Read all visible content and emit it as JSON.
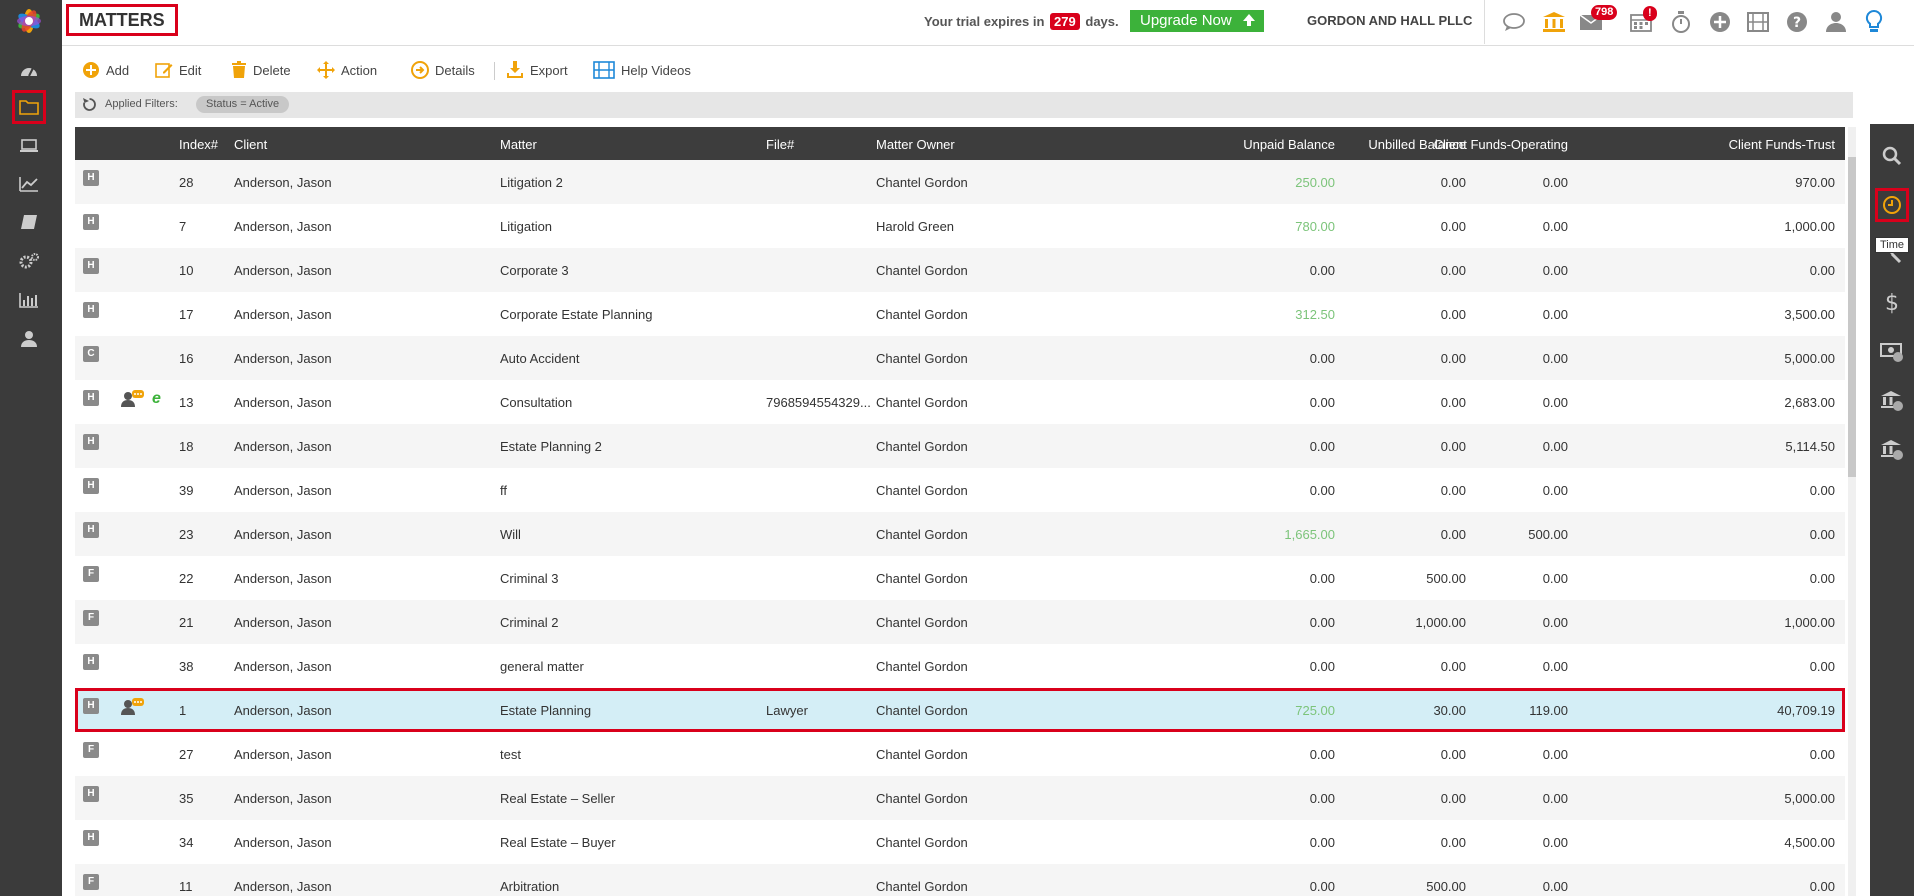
{
  "sidebar": {
    "items": [
      {
        "name": "dashboard-icon"
      },
      {
        "name": "folder-icon",
        "active": true
      },
      {
        "name": "laptop-icon"
      },
      {
        "name": "chart-line-icon"
      },
      {
        "name": "book-icon"
      },
      {
        "name": "gears-icon"
      },
      {
        "name": "bar-chart-icon"
      },
      {
        "name": "user-icon"
      }
    ]
  },
  "header": {
    "title": "MATTERS",
    "trial_prefix": "Your trial expires in",
    "trial_days": "279",
    "trial_suffix": "days.",
    "upgrade_label": "Upgrade Now",
    "firm_name": "GORDON AND HALL PLLC",
    "mail_count": "798",
    "calendar_badge": "!"
  },
  "toolbar": {
    "add": "Add",
    "edit": "Edit",
    "delete": "Delete",
    "action": "Action",
    "details": "Details",
    "export": "Export",
    "help_videos": "Help Videos"
  },
  "filters": {
    "label": "Applied Filters:",
    "chip": "Status = Active"
  },
  "table": {
    "columns": {
      "index": "Index#",
      "client": "Client",
      "matter": "Matter",
      "file": "File#",
      "owner": "Matter Owner",
      "unpaid": "Unpaid Balance",
      "unbilled": "Unbilled Balance",
      "operating": "Client Funds-Operating",
      "trust": "Client Funds-Trust"
    },
    "rows": [
      {
        "badge": "H",
        "index": "28",
        "client": "Anderson, Jason",
        "matter": "Litigation 2",
        "file": "",
        "owner": "Chantel Gordon",
        "unpaid": "250.00",
        "unbilled": "0.00",
        "operating": "0.00",
        "trust": "970.00",
        "unpaid_positive": true
      },
      {
        "badge": "H",
        "index": "7",
        "client": "Anderson, Jason",
        "matter": "Litigation",
        "file": "",
        "owner": "Harold Green",
        "unpaid": "780.00",
        "unbilled": "0.00",
        "operating": "0.00",
        "trust": "1,000.00",
        "unpaid_positive": true
      },
      {
        "badge": "H",
        "index": "10",
        "client": "Anderson, Jason",
        "matter": "Corporate 3",
        "file": "",
        "owner": "Chantel Gordon",
        "unpaid": "0.00",
        "unbilled": "0.00",
        "operating": "0.00",
        "trust": "0.00"
      },
      {
        "badge": "H",
        "index": "17",
        "client": "Anderson, Jason",
        "matter": "Corporate Estate Planning",
        "file": "",
        "owner": "Chantel Gordon",
        "unpaid": "312.50",
        "unbilled": "0.00",
        "operating": "0.00",
        "trust": "3,500.00",
        "unpaid_positive": true
      },
      {
        "badge": "C",
        "index": "16",
        "client": "Anderson, Jason",
        "matter": "Auto Accident",
        "file": "",
        "owner": "Chantel Gordon",
        "unpaid": "0.00",
        "unbilled": "0.00",
        "operating": "0.00",
        "trust": "5,000.00"
      },
      {
        "badge": "H",
        "index": "13",
        "client": "Anderson, Jason",
        "matter": "Consultation",
        "file": "7968594554329...",
        "owner": "Chantel Gordon",
        "unpaid": "0.00",
        "unbilled": "0.00",
        "operating": "0.00",
        "trust": "2,683.00",
        "icons": [
          "contact",
          "e"
        ]
      },
      {
        "badge": "H",
        "index": "18",
        "client": "Anderson, Jason",
        "matter": "Estate Planning 2",
        "file": "",
        "owner": "Chantel Gordon",
        "unpaid": "0.00",
        "unbilled": "0.00",
        "operating": "0.00",
        "trust": "5,114.50"
      },
      {
        "badge": "H",
        "index": "39",
        "client": "Anderson, Jason",
        "matter": "ff",
        "file": "",
        "owner": "Chantel Gordon",
        "unpaid": "0.00",
        "unbilled": "0.00",
        "operating": "0.00",
        "trust": "0.00"
      },
      {
        "badge": "H",
        "index": "23",
        "client": "Anderson, Jason",
        "matter": "Will",
        "file": "",
        "owner": "Chantel Gordon",
        "unpaid": "1,665.00",
        "unbilled": "0.00",
        "operating": "500.00",
        "trust": "0.00",
        "unpaid_positive": true
      },
      {
        "badge": "F",
        "index": "22",
        "client": "Anderson, Jason",
        "matter": "Criminal 3",
        "file": "",
        "owner": "Chantel Gordon",
        "unpaid": "0.00",
        "unbilled": "500.00",
        "operating": "0.00",
        "trust": "0.00"
      },
      {
        "badge": "F",
        "index": "21",
        "client": "Anderson, Jason",
        "matter": "Criminal 2",
        "file": "",
        "owner": "Chantel Gordon",
        "unpaid": "0.00",
        "unbilled": "1,000.00",
        "operating": "0.00",
        "trust": "1,000.00"
      },
      {
        "badge": "H",
        "index": "38",
        "client": "Anderson, Jason",
        "matter": "general matter",
        "file": "",
        "owner": "Chantel Gordon",
        "unpaid": "0.00",
        "unbilled": "0.00",
        "operating": "0.00",
        "trust": "0.00"
      },
      {
        "badge": "H",
        "index": "1",
        "client": "Anderson, Jason",
        "matter": "Estate Planning",
        "file": "Lawyer",
        "owner": "Chantel Gordon",
        "unpaid": "725.00",
        "unbilled": "30.00",
        "operating": "119.00",
        "trust": "40,709.19",
        "unpaid_positive": true,
        "selected": true,
        "icons": [
          "contact"
        ]
      },
      {
        "badge": "F",
        "index": "27",
        "client": "Anderson, Jason",
        "matter": "test",
        "file": "",
        "owner": "Chantel Gordon",
        "unpaid": "0.00",
        "unbilled": "0.00",
        "operating": "0.00",
        "trust": "0.00"
      },
      {
        "badge": "H",
        "index": "35",
        "client": "Anderson, Jason",
        "matter": "Real Estate – Seller",
        "file": "",
        "owner": "Chantel Gordon",
        "unpaid": "0.00",
        "unbilled": "0.00",
        "operating": "0.00",
        "trust": "5,000.00"
      },
      {
        "badge": "H",
        "index": "34",
        "client": "Anderson, Jason",
        "matter": "Real Estate – Buyer",
        "file": "",
        "owner": "Chantel Gordon",
        "unpaid": "0.00",
        "unbilled": "0.00",
        "operating": "0.00",
        "trust": "4,500.00"
      },
      {
        "badge": "F",
        "index": "11",
        "client": "Anderson, Jason",
        "matter": "Arbitration",
        "file": "",
        "owner": "Chantel Gordon",
        "unpaid": "0.00",
        "unbilled": "500.00",
        "operating": "0.00",
        "trust": "0.00"
      }
    ]
  },
  "rightbar": {
    "items": [
      "search-icon",
      "clock-icon",
      "gavel-icon",
      "dollar-icon",
      "money-icon",
      "bank-icon",
      "bank-icon-2"
    ],
    "tooltip": "Time"
  },
  "colors": {
    "sidebar_bg": "#3b3b3b",
    "accent_red": "#d9001b",
    "upgrade_green": "#3cb23a",
    "icon_orange": "#f0a30a",
    "selected_row": "#d4eef6"
  }
}
